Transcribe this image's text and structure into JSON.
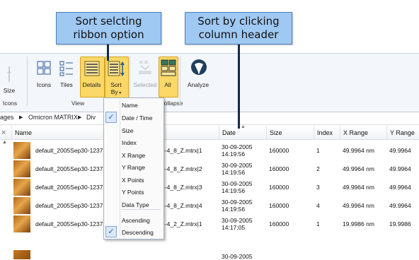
{
  "callouts": {
    "ribbon": {
      "line1": "Sort selcting",
      "line2": "ribbon option"
    },
    "header": {
      "line1": "Sort by clicking",
      "line2": "column header"
    }
  },
  "ribbon": {
    "size_label": "Size",
    "icons_group_label": "Icons",
    "buttons": {
      "icons": "Icons",
      "tiles": "Tiles",
      "details": "Details",
      "sort": "Sort",
      "sort_by": "By",
      "selected": "Selected",
      "all": "All",
      "analyze": "Analyze"
    },
    "groups": {
      "view": "View",
      "collapse": "Collapse"
    }
  },
  "path": {
    "segments": [
      "ages",
      "Omicron MATRIX",
      "Div"
    ]
  },
  "sort_menu": {
    "items": [
      "Name",
      "Date / Time",
      "Size",
      "Index",
      "X Range",
      "Y Range",
      "X Points",
      "Y Points",
      "Data Type",
      "Ascending",
      "Descending"
    ],
    "check_glyph": "✓"
  },
  "table": {
    "close_glyph": "×",
    "columns": {
      "name": "Name",
      "date": "Date",
      "size": "Size",
      "index": "Index",
      "xrange": "X Range",
      "yrange": "Y Range"
    },
    "rows": [
      {
        "prefix": "default_2005Sep30-1237",
        "suffix": "--4_8_Z.mtrx|1",
        "date": "30-09-2005",
        "time": "14:19:56",
        "size": "160000",
        "index": "1",
        "xrange": "49.9964 nm",
        "yrange": "49.9964"
      },
      {
        "prefix": "default_2005Sep30-1237",
        "suffix": "--4_8_Z.mtrx|2",
        "date": "30-09-2005",
        "time": "14:19:56",
        "size": "160000",
        "index": "2",
        "xrange": "49.9964 nm",
        "yrange": "49.9964"
      },
      {
        "prefix": "default_2005Sep30-1237",
        "suffix": "--4_8_Z.mtrx|3",
        "date": "30-09-2005",
        "time": "14:19:56",
        "size": "160000",
        "index": "3",
        "xrange": "49.9964 nm",
        "yrange": "49.9964"
      },
      {
        "prefix": "default_2005Sep30-1237",
        "suffix": "--4_8_Z.mtrx|4",
        "date": "30-09-2005",
        "time": "14:19:56",
        "size": "160000",
        "index": "4",
        "xrange": "49.9964 nm",
        "yrange": "49.9964"
      },
      {
        "prefix": "default_2005Sep30-1237",
        "suffix": "--4_2_Z.mtrx|1",
        "date": "30-09-2005",
        "time": "14:17:05",
        "size": "160000",
        "index": "1",
        "xrange": "19.9986 nm",
        "yrange": "19.9986"
      }
    ],
    "partial_date": "30-09-2005"
  }
}
